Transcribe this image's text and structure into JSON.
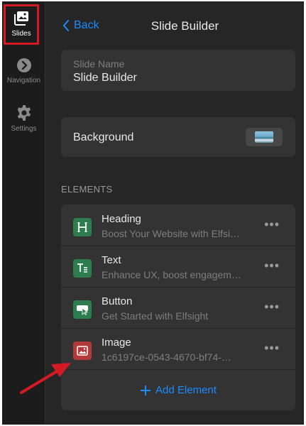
{
  "sidebar": {
    "items": [
      {
        "label": "Slides",
        "icon": "slides-icon",
        "active": true
      },
      {
        "label": "Navigation",
        "icon": "chevron-right-circle-icon",
        "active": false
      },
      {
        "label": "Settings",
        "icon": "gear-icon",
        "active": false
      }
    ]
  },
  "header": {
    "back_label": "Back",
    "title": "Slide Builder"
  },
  "slide_name": {
    "label": "Slide Name",
    "value": "Slide Builder"
  },
  "background": {
    "label": "Background",
    "thumbnail_icon": "image-thumbnail"
  },
  "elements": {
    "section_title": "ELEMENTS",
    "items": [
      {
        "name": "Heading",
        "desc": "Boost Your Website with Elfsi…",
        "icon": "heading-icon",
        "color": "#2e7d4f"
      },
      {
        "name": "Text",
        "desc": "Enhance UX, boost engagem…",
        "icon": "text-icon",
        "color": "#2e7d4f"
      },
      {
        "name": "Button",
        "desc": "Get Started with Elfsight",
        "icon": "button-icon",
        "color": "#2e7d4f"
      },
      {
        "name": "Image",
        "desc": "1c6197ce-0543-4670-bf74-…",
        "icon": "image-icon",
        "color": "#b13a3a"
      }
    ],
    "more_label": "•••",
    "add_label": "Add Element"
  },
  "colors": {
    "accent": "#1a8cff",
    "highlight": "#d41a24",
    "panel": "#333334",
    "background": "#262626"
  }
}
